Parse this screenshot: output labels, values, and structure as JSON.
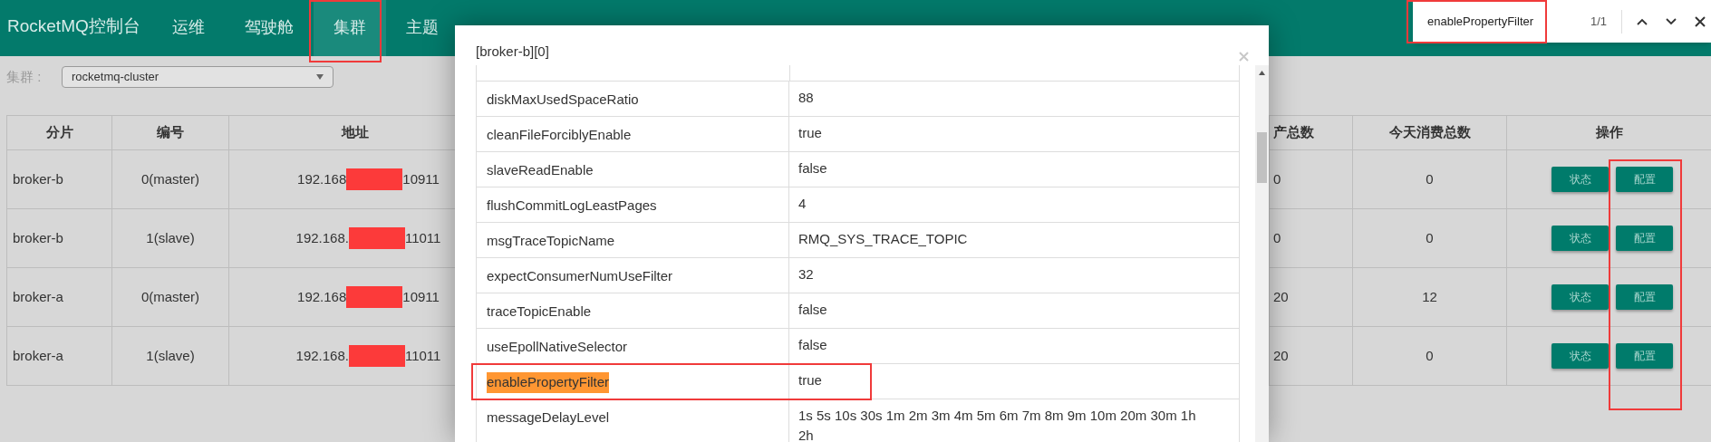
{
  "app_title": "RocketMQ控制台",
  "nav": [
    {
      "label": "运维",
      "selected": false
    },
    {
      "label": "驾驶舱",
      "selected": false
    },
    {
      "label": "集群",
      "selected": true
    },
    {
      "label": "主题",
      "selected": false
    }
  ],
  "find_bar": {
    "query": "enablePropertyFilter",
    "count": "1/1"
  },
  "cluster_filter": {
    "label": "集群 :",
    "value": "rocketmq-cluster"
  },
  "table": {
    "columns": [
      "分片",
      "编号",
      "地址",
      "产总数",
      "今天消费总数",
      "操作"
    ],
    "rows": [
      {
        "shard": "broker-b",
        "number": "0(master)",
        "address_prefix": "192.168",
        "address_suffix": "10911",
        "produced": "0",
        "consumed": "0",
        "actions": [
          "状态",
          "配置"
        ]
      },
      {
        "shard": "broker-b",
        "number": "1(slave)",
        "address_prefix": "192.168.",
        "address_suffix": "11011",
        "produced": "0",
        "consumed": "0",
        "actions": [
          "状态",
          "配置"
        ]
      },
      {
        "shard": "broker-a",
        "number": "0(master)",
        "address_prefix": "192.168",
        "address_suffix": "10911",
        "produced": "20",
        "consumed": "12",
        "actions": [
          "状态",
          "配置"
        ]
      },
      {
        "shard": "broker-a",
        "number": "1(slave)",
        "address_prefix": "192.168.",
        "address_suffix": "11011",
        "produced": "20",
        "consumed": "0",
        "actions": [
          "状态",
          "配置"
        ]
      }
    ]
  },
  "dialog": {
    "title": "[broker-b][0]",
    "rows": [
      {
        "key": "diskMaxUsedSpaceRatio",
        "value": "88",
        "highlighted": false
      },
      {
        "key": "cleanFileForciblyEnable",
        "value": "true",
        "highlighted": false
      },
      {
        "key": "slaveReadEnable",
        "value": "false",
        "highlighted": false
      },
      {
        "key": "flushCommitLogLeastPages",
        "value": "4",
        "highlighted": false
      },
      {
        "key": "msgTraceTopicName",
        "value": "RMQ_SYS_TRACE_TOPIC",
        "highlighted": false
      },
      {
        "key": "expectConsumerNumUseFilter",
        "value": "32",
        "highlighted": false
      },
      {
        "key": "traceTopicEnable",
        "value": "false",
        "highlighted": false
      },
      {
        "key": "useEpollNativeSelector",
        "value": "false",
        "highlighted": false
      },
      {
        "key": "enablePropertyFilter",
        "value": "true",
        "highlighted": true
      },
      {
        "key": "messageDelayLevel",
        "value": "1s 5s 10s 30s 1m 2m 3m 4m 5m 6m 7m 8m 9m 10m 20m 30m 1h 2h",
        "highlighted": false
      }
    ]
  }
}
